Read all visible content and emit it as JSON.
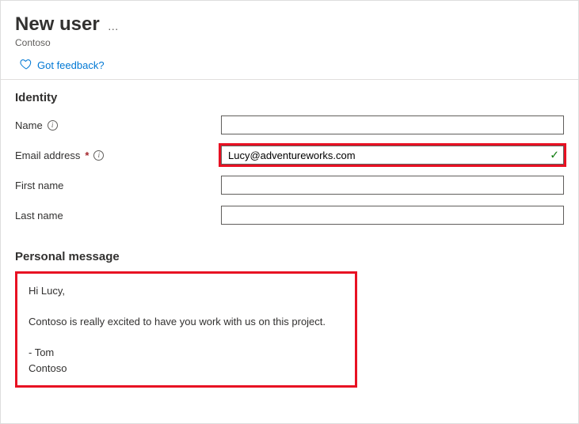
{
  "header": {
    "title": "New user",
    "subtitle": "Contoso",
    "more_actions": "…"
  },
  "feedback": {
    "link_text": "Got feedback?"
  },
  "identity": {
    "heading": "Identity",
    "name": {
      "label": "Name",
      "value": ""
    },
    "email": {
      "label": "Email address",
      "value": "Lucy@adventureworks.com",
      "required": "*"
    },
    "first_name": {
      "label": "First name",
      "value": ""
    },
    "last_name": {
      "label": "Last name",
      "value": ""
    }
  },
  "personal_message": {
    "heading": "Personal message",
    "body": "Hi Lucy,\n\nContoso is really excited to have you work with us on this project.\n\n- Tom\nContoso"
  }
}
